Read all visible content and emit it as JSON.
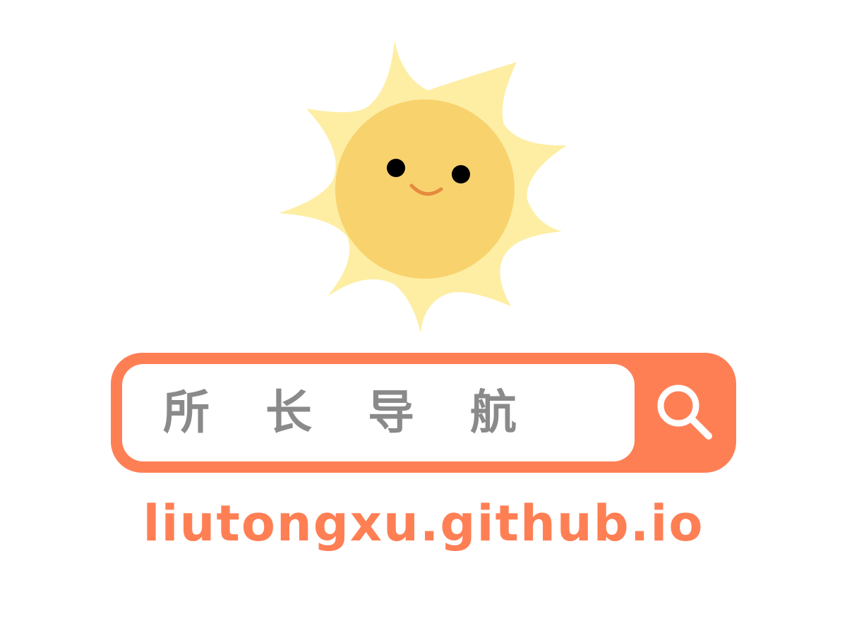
{
  "illustration": {
    "icon": "smiling-sun-icon",
    "ray_color": "#fdeea4",
    "face_color": "#f8d26d",
    "eye_color": "#000000",
    "mouth_color": "#e58a3e"
  },
  "search": {
    "query_text": "所 长 导 航",
    "button_icon": "search-icon",
    "accent_color": "#ff7f55",
    "text_color": "#8a8a8a"
  },
  "footer": {
    "url": "liutongxu.github.io"
  }
}
